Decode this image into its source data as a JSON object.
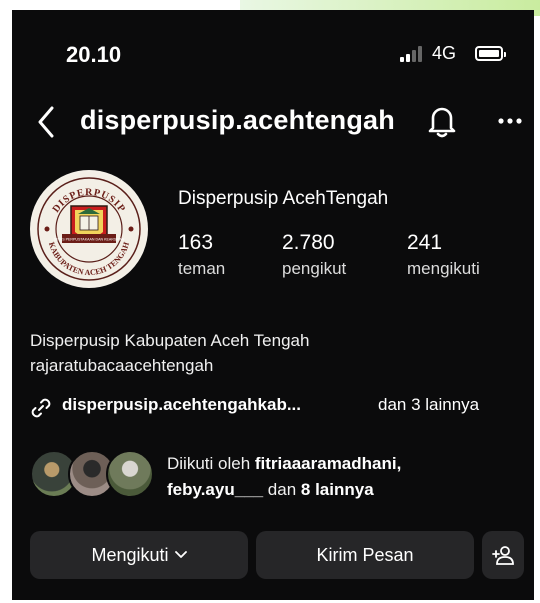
{
  "status": {
    "time": "20.10",
    "network": "4G"
  },
  "header": {
    "username": "disperpusip.acehtengah"
  },
  "profile": {
    "display_name": "Disperpusip AcehTengah",
    "avatar_text_top": "DISPERPUSIP",
    "avatar_text_bottom": "KABUPATEN ACEH TENGAH",
    "avatar_text_inner": "DINAS PERPUSTAKAAN DAN KEARSIPAN",
    "stats": [
      {
        "value": "163",
        "label": "teman"
      },
      {
        "value": "2.780",
        "label": "pengikut"
      },
      {
        "value": "241",
        "label": "mengikuti"
      }
    ],
    "bio_line1": "Disperpusip Kabupaten Aceh Tengah",
    "bio_line2": "rajaratubacaacehtengah",
    "link_text": "disperpusip.acehtengahkab...",
    "link_more": "dan 3 lainnya"
  },
  "followed_by": {
    "prefix": "Diikuti oleh ",
    "user1": "fitriaaaramadhani,",
    "user2": "feby.ayu___",
    "suffix": " dan ",
    "more": "8 lainnya"
  },
  "actions": {
    "follow_label": "Mengikuti",
    "message_label": "Kirim Pesan"
  }
}
